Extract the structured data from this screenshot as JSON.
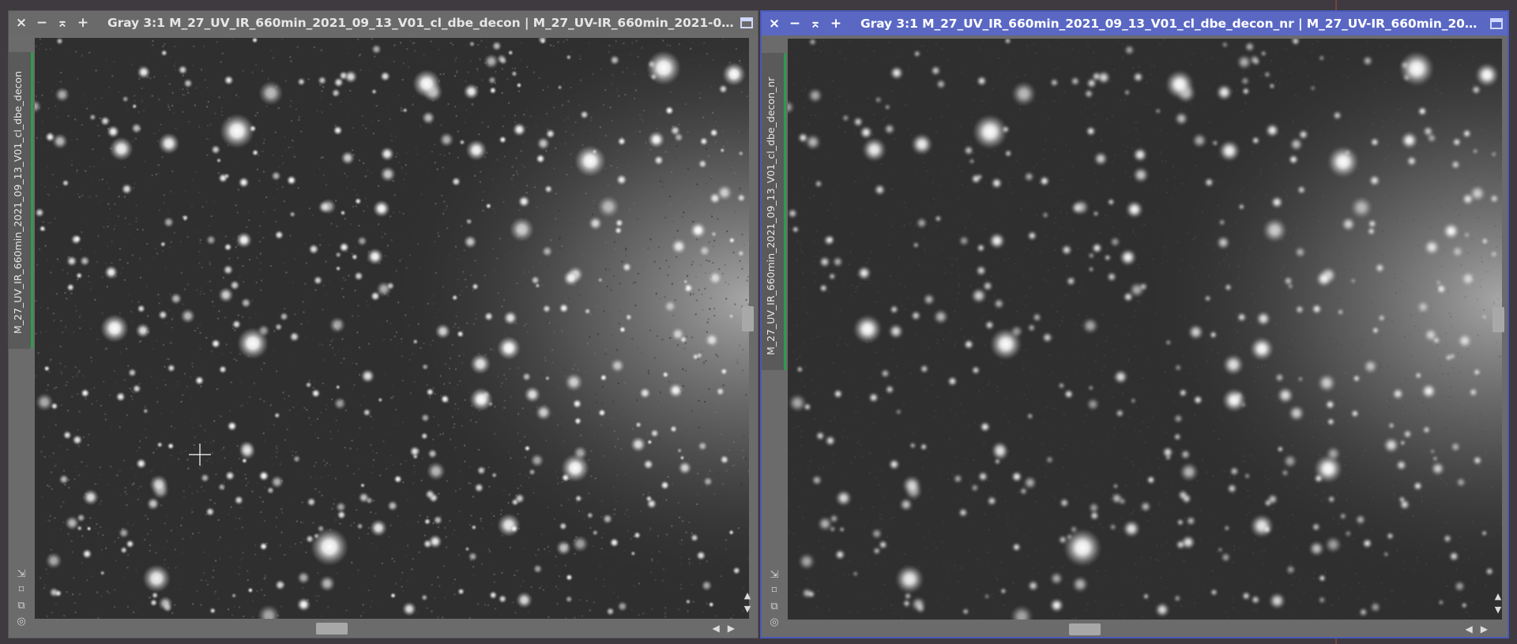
{
  "windows": [
    {
      "id": "left",
      "title": "Gray 3:1 M_27_UV_IR_660min_2021_09_13_V01_cl_dbe_decon | M_27_UV-IR_660min_2021-09-...",
      "side_label": "M_27_UV_IR_660min_2021_09_13_V01_cl_dbe_decon",
      "active": false,
      "seed": 7,
      "noise": 0.62,
      "blur": 0.7
    },
    {
      "id": "right",
      "title": "Gray 3:1 M_27_UV_IR_660min_2021_09_13_V01_cl_dbe_decon_nr | M_27_UV-IR_660min_2021-...",
      "side_label": "M_27_UV_IR_660min_2021_09_13_V01_cl_dbe_decon_nr",
      "active": true,
      "seed": 7,
      "noise": 0.18,
      "blur": 1.6
    }
  ],
  "titlebar_buttons": {
    "close": "×",
    "minimize": "−",
    "shade": "⌅",
    "maximize_plus": "+"
  },
  "tool_icons": [
    "arrow-corner-icon",
    "fit-frame-icon",
    "clone-icon",
    "target-icon"
  ],
  "scroll_arrows": {
    "up": "▲",
    "down": "▼",
    "left": "◀",
    "right": "▶"
  },
  "colors": {
    "active_title": "#5a68c4",
    "inactive_title": "#6a6a6a",
    "side_accent": "#2f9a4c"
  }
}
